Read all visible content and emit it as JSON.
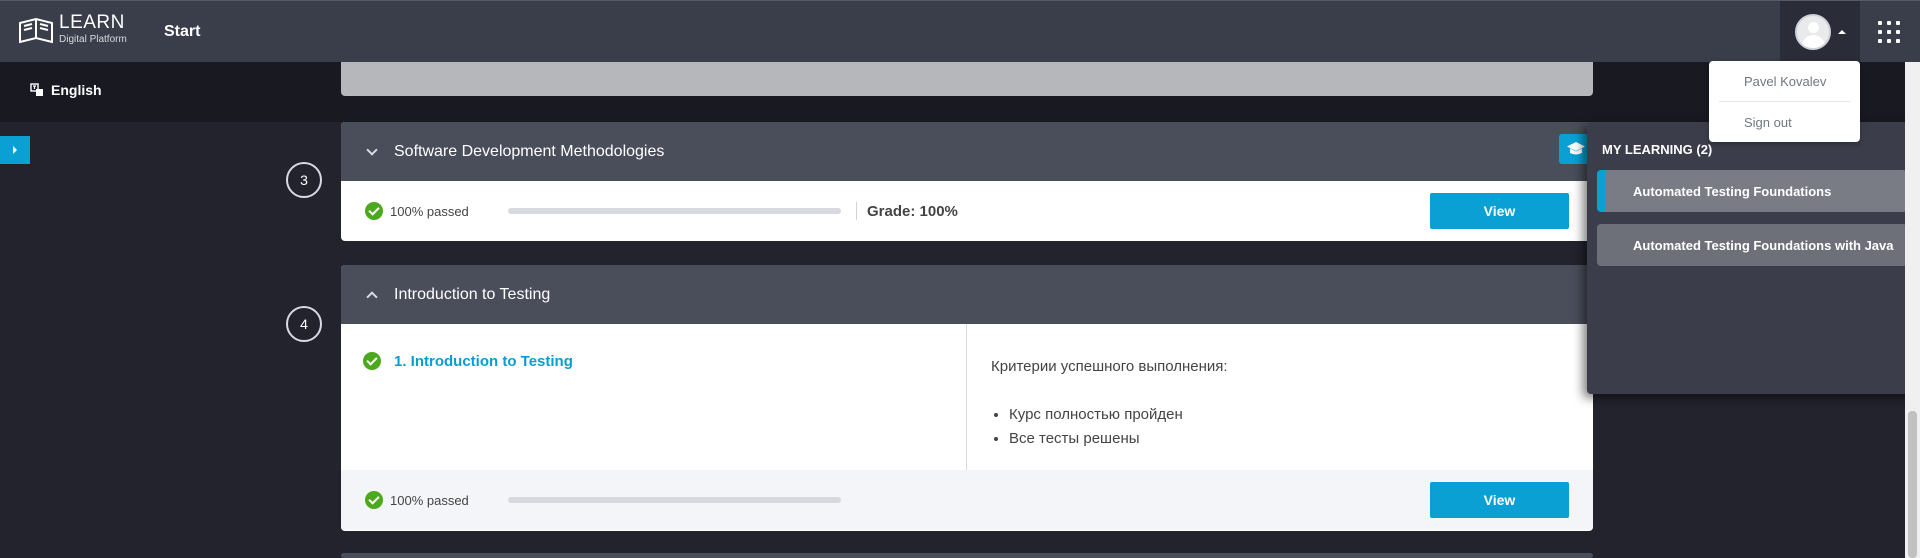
{
  "header": {
    "logo_title": "LEARN",
    "logo_subtitle": "Digital Platform",
    "nav_start": "Start"
  },
  "language": "English",
  "user_menu": {
    "name": "Pavel Kovalev",
    "sign_out": "Sign out"
  },
  "courses": [
    {
      "number": "3",
      "title": "Software Development Methodologies",
      "passed": "100% passed",
      "grade": "Grade: 100%",
      "view_label": "View"
    },
    {
      "number": "4",
      "title": "Introduction to Testing",
      "lesson": "1. Introduction to Testing",
      "criteria_title": "Критерии успешного выполнения:",
      "criteria": [
        "Курс полностью пройден",
        "Все тесты решены"
      ],
      "passed": "100% passed",
      "view_label": "View"
    }
  ],
  "my_learning": {
    "title": "MY LEARNING (2)",
    "items": [
      "Automated Testing Foundations",
      "Automated Testing Foundations with Java"
    ]
  },
  "colors": {
    "accent": "#0aa0d4",
    "success": "#4ca91e",
    "header_bg": "#3a3e4b",
    "card_header": "#4a4d5a"
  }
}
